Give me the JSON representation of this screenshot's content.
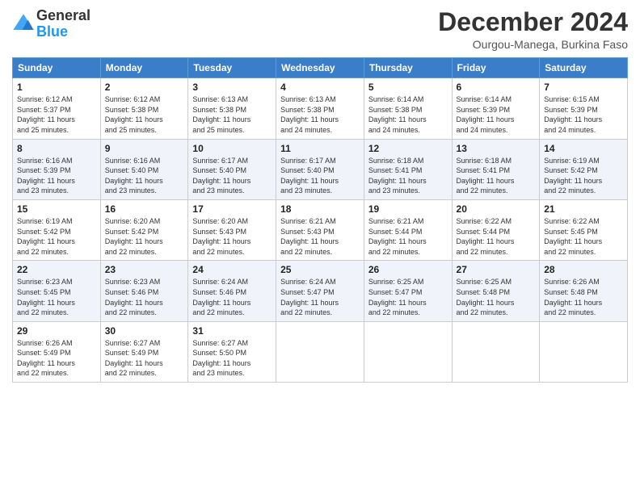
{
  "header": {
    "logo_general": "General",
    "logo_blue": "Blue",
    "month_title": "December 2024",
    "location": "Ourgou-Manega, Burkina Faso"
  },
  "days_of_week": [
    "Sunday",
    "Monday",
    "Tuesday",
    "Wednesday",
    "Thursday",
    "Friday",
    "Saturday"
  ],
  "weeks": [
    [
      {
        "day": "1",
        "info": "Sunrise: 6:12 AM\nSunset: 5:37 PM\nDaylight: 11 hours\nand 25 minutes."
      },
      {
        "day": "2",
        "info": "Sunrise: 6:12 AM\nSunset: 5:38 PM\nDaylight: 11 hours\nand 25 minutes."
      },
      {
        "day": "3",
        "info": "Sunrise: 6:13 AM\nSunset: 5:38 PM\nDaylight: 11 hours\nand 25 minutes."
      },
      {
        "day": "4",
        "info": "Sunrise: 6:13 AM\nSunset: 5:38 PM\nDaylight: 11 hours\nand 24 minutes."
      },
      {
        "day": "5",
        "info": "Sunrise: 6:14 AM\nSunset: 5:38 PM\nDaylight: 11 hours\nand 24 minutes."
      },
      {
        "day": "6",
        "info": "Sunrise: 6:14 AM\nSunset: 5:39 PM\nDaylight: 11 hours\nand 24 minutes."
      },
      {
        "day": "7",
        "info": "Sunrise: 6:15 AM\nSunset: 5:39 PM\nDaylight: 11 hours\nand 24 minutes."
      }
    ],
    [
      {
        "day": "8",
        "info": "Sunrise: 6:16 AM\nSunset: 5:39 PM\nDaylight: 11 hours\nand 23 minutes."
      },
      {
        "day": "9",
        "info": "Sunrise: 6:16 AM\nSunset: 5:40 PM\nDaylight: 11 hours\nand 23 minutes."
      },
      {
        "day": "10",
        "info": "Sunrise: 6:17 AM\nSunset: 5:40 PM\nDaylight: 11 hours\nand 23 minutes."
      },
      {
        "day": "11",
        "info": "Sunrise: 6:17 AM\nSunset: 5:40 PM\nDaylight: 11 hours\nand 23 minutes."
      },
      {
        "day": "12",
        "info": "Sunrise: 6:18 AM\nSunset: 5:41 PM\nDaylight: 11 hours\nand 23 minutes."
      },
      {
        "day": "13",
        "info": "Sunrise: 6:18 AM\nSunset: 5:41 PM\nDaylight: 11 hours\nand 22 minutes."
      },
      {
        "day": "14",
        "info": "Sunrise: 6:19 AM\nSunset: 5:42 PM\nDaylight: 11 hours\nand 22 minutes."
      }
    ],
    [
      {
        "day": "15",
        "info": "Sunrise: 6:19 AM\nSunset: 5:42 PM\nDaylight: 11 hours\nand 22 minutes."
      },
      {
        "day": "16",
        "info": "Sunrise: 6:20 AM\nSunset: 5:42 PM\nDaylight: 11 hours\nand 22 minutes."
      },
      {
        "day": "17",
        "info": "Sunrise: 6:20 AM\nSunset: 5:43 PM\nDaylight: 11 hours\nand 22 minutes."
      },
      {
        "day": "18",
        "info": "Sunrise: 6:21 AM\nSunset: 5:43 PM\nDaylight: 11 hours\nand 22 minutes."
      },
      {
        "day": "19",
        "info": "Sunrise: 6:21 AM\nSunset: 5:44 PM\nDaylight: 11 hours\nand 22 minutes."
      },
      {
        "day": "20",
        "info": "Sunrise: 6:22 AM\nSunset: 5:44 PM\nDaylight: 11 hours\nand 22 minutes."
      },
      {
        "day": "21",
        "info": "Sunrise: 6:22 AM\nSunset: 5:45 PM\nDaylight: 11 hours\nand 22 minutes."
      }
    ],
    [
      {
        "day": "22",
        "info": "Sunrise: 6:23 AM\nSunset: 5:45 PM\nDaylight: 11 hours\nand 22 minutes."
      },
      {
        "day": "23",
        "info": "Sunrise: 6:23 AM\nSunset: 5:46 PM\nDaylight: 11 hours\nand 22 minutes."
      },
      {
        "day": "24",
        "info": "Sunrise: 6:24 AM\nSunset: 5:46 PM\nDaylight: 11 hours\nand 22 minutes."
      },
      {
        "day": "25",
        "info": "Sunrise: 6:24 AM\nSunset: 5:47 PM\nDaylight: 11 hours\nand 22 minutes."
      },
      {
        "day": "26",
        "info": "Sunrise: 6:25 AM\nSunset: 5:47 PM\nDaylight: 11 hours\nand 22 minutes."
      },
      {
        "day": "27",
        "info": "Sunrise: 6:25 AM\nSunset: 5:48 PM\nDaylight: 11 hours\nand 22 minutes."
      },
      {
        "day": "28",
        "info": "Sunrise: 6:26 AM\nSunset: 5:48 PM\nDaylight: 11 hours\nand 22 minutes."
      }
    ],
    [
      {
        "day": "29",
        "info": "Sunrise: 6:26 AM\nSunset: 5:49 PM\nDaylight: 11 hours\nand 22 minutes."
      },
      {
        "day": "30",
        "info": "Sunrise: 6:27 AM\nSunset: 5:49 PM\nDaylight: 11 hours\nand 22 minutes."
      },
      {
        "day": "31",
        "info": "Sunrise: 6:27 AM\nSunset: 5:50 PM\nDaylight: 11 hours\nand 23 minutes."
      },
      {
        "day": "",
        "info": ""
      },
      {
        "day": "",
        "info": ""
      },
      {
        "day": "",
        "info": ""
      },
      {
        "day": "",
        "info": ""
      }
    ]
  ]
}
